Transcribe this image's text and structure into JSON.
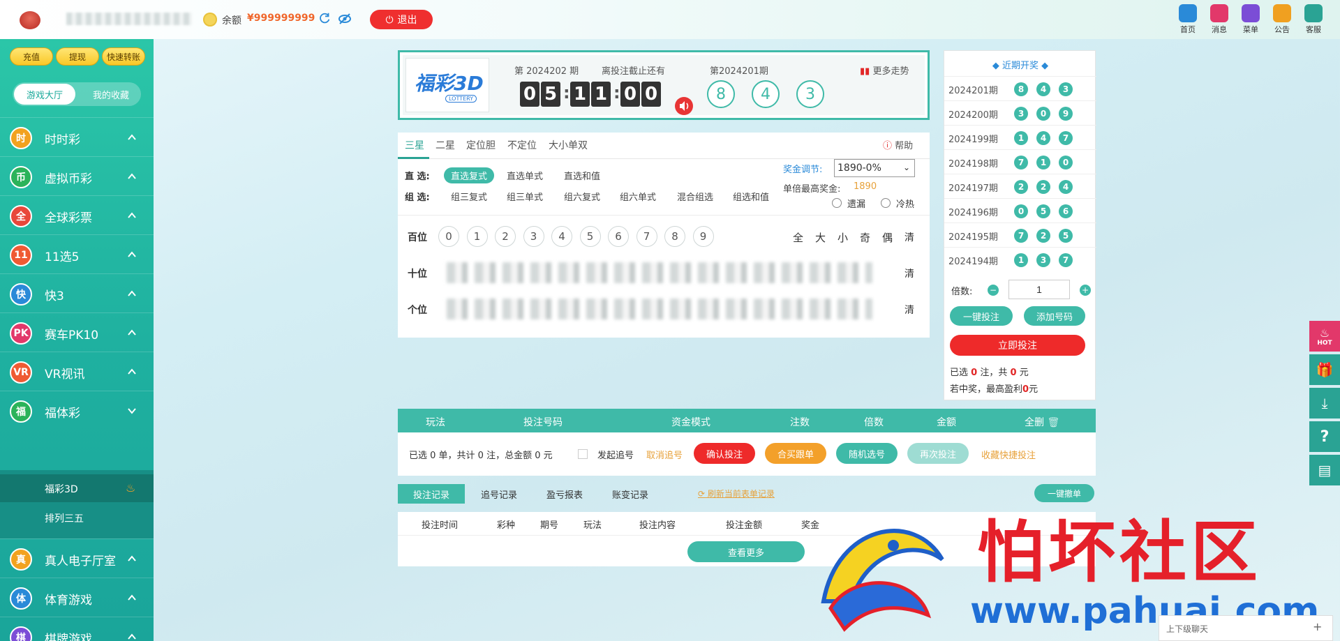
{
  "topbar": {
    "balance_label": "余额",
    "balance_value": "¥999999999",
    "logout": "退出",
    "icons": [
      {
        "label": "首页",
        "icon": "home-icon",
        "color": "#2a8ad8"
      },
      {
        "label": "消息",
        "icon": "mail-icon",
        "color": "#e2386a"
      },
      {
        "label": "菜单",
        "icon": "menu-icon",
        "color": "#7b4dd6"
      },
      {
        "label": "公告",
        "icon": "notice-icon",
        "color": "#f0a020"
      },
      {
        "label": "客服",
        "icon": "support-icon",
        "color": "#2aa394"
      }
    ]
  },
  "sidebar": {
    "top_buttons": [
      "充值",
      "提现",
      "快速转账"
    ],
    "tabs": {
      "hall": "游戏大厅",
      "favorites": "我的收藏"
    },
    "categories": [
      {
        "label": "时时彩",
        "icon_text": "时"
      },
      {
        "label": "虚拟币彩",
        "icon_text": "币"
      },
      {
        "label": "全球彩票",
        "icon_text": "全"
      },
      {
        "label": "11选5",
        "icon_text": "11"
      },
      {
        "label": "快3",
        "icon_text": "快"
      },
      {
        "label": "赛车PK10",
        "icon_text": "PK"
      },
      {
        "label": "VR视讯",
        "icon_text": "VR"
      },
      {
        "label": "福体彩",
        "icon_text": "福"
      },
      {
        "label": "真人电子厅室",
        "icon_text": "真"
      },
      {
        "label": "体育游戏",
        "icon_text": "体"
      },
      {
        "label": "棋牌游戏",
        "icon_text": "棋"
      }
    ],
    "subitems": [
      "福彩3D",
      "排列三五"
    ]
  },
  "header": {
    "logo": "福彩3D",
    "logo_sub": "LOTTERY",
    "current_issue": "第 2024202 期",
    "deadline_label": "离投注截止还有",
    "countdown": [
      "0",
      "5",
      "1",
      "1",
      "0",
      "0"
    ],
    "prev_issue": "第2024201期",
    "trend": "更多走势",
    "prev_balls": [
      "8",
      "4",
      "3"
    ]
  },
  "play": {
    "tabs": [
      "三星",
      "二星",
      "定位胆",
      "不定位",
      "大小单双"
    ],
    "help": "帮助",
    "direct_label": "直 选:",
    "direct_opts": [
      "直选复式",
      "直选单式",
      "直选和值"
    ],
    "group_label": "组 选:",
    "group_opts": [
      "组三复式",
      "组三单式",
      "组六复式",
      "组六单式",
      "混合组选",
      "组选和值"
    ],
    "bonus_label": "奖金调节:",
    "bonus_value": "1890-0%",
    "maxprize_label": "单倍最高奖金:",
    "maxprize_value": "1890",
    "radio_missing": "遗漏",
    "radio_hot": "冷热",
    "positions": [
      "百位",
      "十位",
      "个位"
    ],
    "numbers": [
      "0",
      "1",
      "2",
      "3",
      "4",
      "5",
      "6",
      "7",
      "8",
      "9"
    ],
    "quick": [
      "全",
      "大",
      "小",
      "奇",
      "偶"
    ],
    "clear": "清"
  },
  "history": {
    "title": "近期开奖",
    "rows": [
      {
        "issue": "2024201期",
        "balls": [
          "8",
          "4",
          "3"
        ]
      },
      {
        "issue": "2024200期",
        "balls": [
          "3",
          "0",
          "9"
        ]
      },
      {
        "issue": "2024199期",
        "balls": [
          "1",
          "4",
          "7"
        ]
      },
      {
        "issue": "2024198期",
        "balls": [
          "7",
          "1",
          "0"
        ]
      },
      {
        "issue": "2024197期",
        "balls": [
          "2",
          "2",
          "4"
        ]
      },
      {
        "issue": "2024196期",
        "balls": [
          "0",
          "5",
          "6"
        ]
      },
      {
        "issue": "2024195期",
        "balls": [
          "7",
          "2",
          "5"
        ]
      },
      {
        "issue": "2024194期",
        "balls": [
          "1",
          "3",
          "7"
        ]
      }
    ],
    "mult_label": "倍数:",
    "mult_value": "1",
    "btn_one_click": "一键投注",
    "btn_add": "添加号码",
    "btn_bet_now": "立即投注",
    "sel_pre": "已选",
    "sel_count": "0",
    "sel_mid": "注，共",
    "sel_amount": "0",
    "sel_unit": "元",
    "win_pre": "若中奖，最高盈利",
    "win_value": "0",
    "win_unit": "元"
  },
  "cart": {
    "headers": [
      "玩法",
      "投注号码",
      "资金模式",
      "注数",
      "倍数",
      "金额",
      "全删"
    ],
    "summary": "已选 0 单，共计 0 注，总金额 0 元",
    "chase_label": "发起追号",
    "cancel_chase": "取消追号",
    "buttons": [
      {
        "label": "确认投注",
        "color": "#ee2a2a"
      },
      {
        "label": "合买跟单",
        "color": "#f3a02a"
      },
      {
        "label": "随机选号",
        "color": "#3fbaa8"
      },
      {
        "label": "再次投注",
        "color": "#9edcd3"
      }
    ],
    "fav_quick": "收藏快捷投注"
  },
  "records": {
    "tabs": [
      "投注记录",
      "追号记录",
      "盈亏报表",
      "账变记录"
    ],
    "refresh": "刷新当前表单记录",
    "cancel_all": "一键撤单",
    "headers": [
      "投注时间",
      "彩种",
      "期号",
      "玩法",
      "投注内容",
      "投注金额",
      "奖金"
    ],
    "more": "查看更多"
  },
  "watermark": {
    "text": "怕坏社区",
    "url": "www.pahuai.com"
  },
  "float_bar": {
    "hot": "HOT"
  },
  "bottom_widget": "上下级聊天"
}
